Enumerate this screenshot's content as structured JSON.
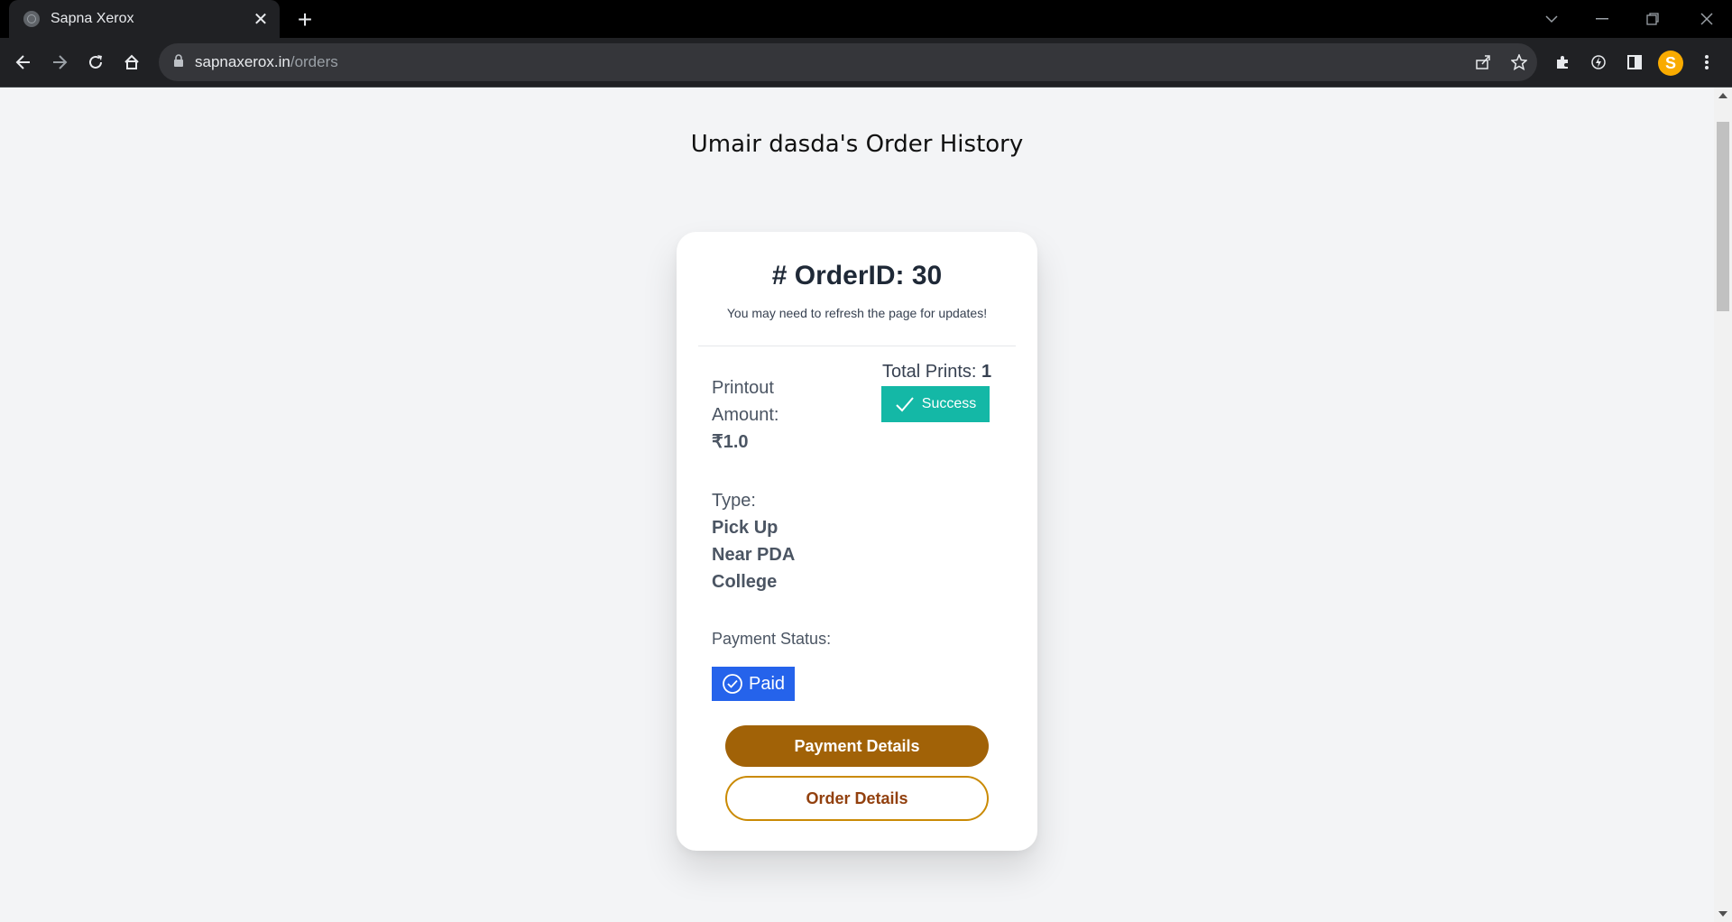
{
  "browser": {
    "tab_title": "Sapna Xerox",
    "url_host": "sapnaxerox.in",
    "url_path": "/orders",
    "profile_initial": "S"
  },
  "page": {
    "title": "Umair dasda's Order History"
  },
  "order": {
    "id_label": "# OrderID: 30",
    "refresh_note": "You may need to refresh the page for updates!",
    "total_prints_label": "Total Prints:",
    "total_prints_value": "1",
    "status": "Success",
    "amount_label_line1": "Printout",
    "amount_label_line2": "Amount:",
    "amount_value": "₹1.0",
    "type_label": "Type:",
    "type_value_line1": "Pick Up",
    "type_value_line2": "Near PDA",
    "type_value_line3": "College",
    "payment_status_label": "Payment Status:",
    "payment_status": "Paid",
    "payment_details_button": "Payment Details",
    "order_details_button": "Order Details"
  },
  "colors": {
    "success": "#14b8a6",
    "paid": "#2563eb",
    "primary_button": "#a16207",
    "outline_button_border": "#ca8a04"
  },
  "icons": {
    "status": "checkmark-icon",
    "paid": "check-circle-icon"
  }
}
